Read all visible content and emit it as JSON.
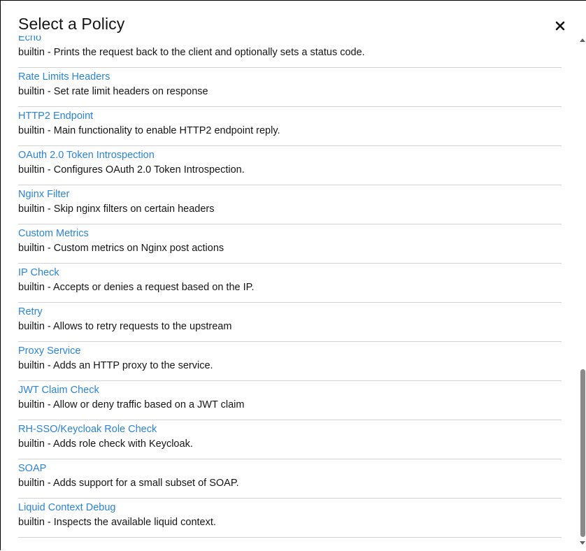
{
  "modal": {
    "title": "Select a Policy",
    "close_label": "close"
  },
  "policies": [
    {
      "name": "Echo",
      "description": "builtin - Prints the request back to the client and optionally sets a status code."
    },
    {
      "name": "Rate Limits Headers",
      "description": "builtin - Set rate limit headers on response"
    },
    {
      "name": "HTTP2 Endpoint",
      "description": "builtin - Main functionality to enable HTTP2 endpoint reply."
    },
    {
      "name": "OAuth 2.0 Token Introspection",
      "description": "builtin - Configures OAuth 2.0 Token Introspection."
    },
    {
      "name": "Nginx Filter",
      "description": "builtin - Skip nginx filters on certain headers"
    },
    {
      "name": "Custom Metrics",
      "description": "builtin - Custom metrics on Nginx post actions"
    },
    {
      "name": "IP Check",
      "description": "builtin - Accepts or denies a request based on the IP."
    },
    {
      "name": "Retry",
      "description": "builtin - Allows to retry requests to the upstream"
    },
    {
      "name": "Proxy Service",
      "description": "builtin - Adds an HTTP proxy to the service."
    },
    {
      "name": "JWT Claim Check",
      "description": "builtin - Allow or deny traffic based on a JWT claim"
    },
    {
      "name": "RH-SSO/Keycloak Role Check",
      "description": "builtin - Adds role check with Keycloak."
    },
    {
      "name": "SOAP",
      "description": "builtin - Adds support for a small subset of SOAP."
    },
    {
      "name": "Liquid Context Debug",
      "description": "builtin - Inspects the available liquid context."
    }
  ],
  "colors": {
    "link": "#2b84d6",
    "text": "#151515",
    "divider": "#d2d2d2"
  },
  "scroll": {
    "position_fraction": 1.0
  },
  "icons": {
    "close": "close-icon",
    "scroll_up": "scroll-up-arrow-icon",
    "scroll_down": "scroll-down-arrow-icon"
  }
}
